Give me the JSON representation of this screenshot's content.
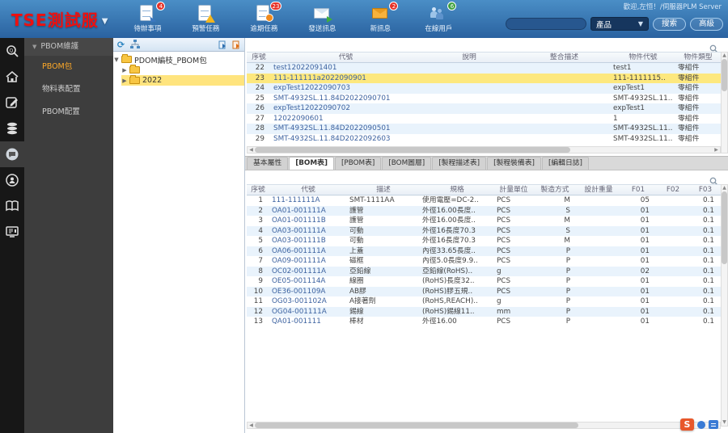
{
  "header": {
    "brand": "TSE測試服",
    "welcome": "歡迎,左恒！/伺服器PLM Server",
    "toolbar": [
      {
        "icon": "todo-icon",
        "label": "待辦事項",
        "badge": "4",
        "badge_color": "red"
      },
      {
        "icon": "warning-task-icon",
        "label": "預警任務",
        "badge": "",
        "badge_color": ""
      },
      {
        "icon": "overdue-task-icon",
        "label": "逾期任務",
        "badge": "23",
        "badge_color": "red"
      },
      {
        "icon": "send-message-icon",
        "label": "發送訊息",
        "badge": "",
        "badge_color": ""
      },
      {
        "icon": "new-message-icon",
        "label": "新訊息",
        "badge": "2",
        "badge_color": "red"
      },
      {
        "icon": "online-users-icon",
        "label": "在線用戶",
        "badge": "6",
        "badge_color": "green"
      }
    ],
    "search": {
      "value": "",
      "placeholder": "",
      "category": "產品",
      "search_btn": "搜索",
      "advanced_btn": "高級"
    }
  },
  "icon_rail": [
    {
      "name": "search-icon",
      "active": false
    },
    {
      "name": "home-icon",
      "active": false
    },
    {
      "name": "edit-icon",
      "active": false
    },
    {
      "name": "database-icon",
      "active": false
    },
    {
      "name": "chat-icon",
      "active": true
    },
    {
      "name": "support-icon",
      "active": false
    },
    {
      "name": "book-icon",
      "active": false
    },
    {
      "name": "monitor-icon",
      "active": false
    }
  ],
  "sidebar": {
    "group": "PBOM維護",
    "items": [
      {
        "label": "PBOM包",
        "selected": true
      },
      {
        "label": "物料表配置",
        "selected": false
      },
      {
        "label": "PBOM配置",
        "selected": false
      }
    ]
  },
  "tree": {
    "root": "PDOM編枝_PBOM包",
    "children": [
      {
        "label": "",
        "selected": false
      },
      {
        "label": "2022",
        "selected": true
      }
    ]
  },
  "top_table": {
    "headers": [
      "序號",
      "代號",
      "說明",
      "整合描述",
      "物件代號",
      "物件類型"
    ],
    "rows": [
      {
        "seq": "22",
        "code": "test12022091401",
        "desc": "",
        "merge_desc": "",
        "obj_code": "test1",
        "obj_type": "零組件",
        "selected": false
      },
      {
        "seq": "23",
        "code": "111-111111a2022090901",
        "desc": "",
        "merge_desc": "",
        "obj_code": "111-1111115..",
        "obj_type": "零組件",
        "selected": true
      },
      {
        "seq": "24",
        "code": "expTest12022090703",
        "desc": "",
        "merge_desc": "",
        "obj_code": "expTest1",
        "obj_type": "零組件",
        "selected": false
      },
      {
        "seq": "25",
        "code": "SMT-4932SL.11.84D2022090701",
        "desc": "",
        "merge_desc": "",
        "obj_code": "SMT-4932SL.11..",
        "obj_type": "零組件",
        "selected": false
      },
      {
        "seq": "26",
        "code": "expTest12022090702",
        "desc": "",
        "merge_desc": "",
        "obj_code": "expTest1",
        "obj_type": "零組件",
        "selected": false
      },
      {
        "seq": "27",
        "code": "12022090601",
        "desc": "",
        "merge_desc": "",
        "obj_code": "1",
        "obj_type": "零組件",
        "selected": false
      },
      {
        "seq": "28",
        "code": "SMT-4932SL.11.84D2022090501",
        "desc": "",
        "merge_desc": "",
        "obj_code": "SMT-4932SL.11..",
        "obj_type": "零組件",
        "selected": false
      },
      {
        "seq": "29",
        "code": "SMT-4932SL.11.84D2022092603",
        "desc": "",
        "merge_desc": "",
        "obj_code": "SMT-4932SL.11..",
        "obj_type": "零組件",
        "selected": false
      }
    ]
  },
  "tabs": [
    {
      "label": "基本屬性",
      "active": false
    },
    {
      "label": "[BOM表]",
      "active": true
    },
    {
      "label": "[PBOM表]",
      "active": false
    },
    {
      "label": "[BOM圖層]",
      "active": false
    },
    {
      "label": "[製程描述表]",
      "active": false
    },
    {
      "label": "[製程裝備表]",
      "active": false
    },
    {
      "label": "[編輯日誌]",
      "active": false
    }
  ],
  "bottom_table": {
    "headers": [
      "序號",
      "代號",
      "描述",
      "規格",
      "計量單位",
      "製造方式",
      "設計重量",
      "F01",
      "F02",
      "F03"
    ],
    "rows": [
      {
        "seq": "1",
        "code": "111-111111A",
        "desc": "SMT-1111AA",
        "spec": "使用電壓=DC-2..",
        "unit": "PCS",
        "make": "M",
        "weight": "",
        "f01": "05",
        "f02": "",
        "f03": "0.1"
      },
      {
        "seq": "2",
        "code": "OA01-001111A",
        "desc": "護管",
        "spec": "外徑16.00長度..",
        "unit": "PCS",
        "make": "S",
        "weight": "",
        "f01": "01",
        "f02": "",
        "f03": "0.1"
      },
      {
        "seq": "3",
        "code": "OA01-001111B",
        "desc": "護管",
        "spec": "外徑16.00長度..",
        "unit": "PCS",
        "make": "M",
        "weight": "",
        "f01": "01",
        "f02": "",
        "f03": "0.1"
      },
      {
        "seq": "4",
        "code": "OA03-001111A",
        "desc": "可動",
        "spec": "外徑16長度70.3",
        "unit": "PCS",
        "make": "S",
        "weight": "",
        "f01": "01",
        "f02": "",
        "f03": "0.1"
      },
      {
        "seq": "5",
        "code": "OA03-001111B",
        "desc": "可動",
        "spec": "外徑16長度70.3",
        "unit": "PCS",
        "make": "M",
        "weight": "",
        "f01": "01",
        "f02": "",
        "f03": "0.1"
      },
      {
        "seq": "6",
        "code": "OA06-001111A",
        "desc": "上蓋",
        "spec": "內徑33.65長度..",
        "unit": "PCS",
        "make": "P",
        "weight": "",
        "f01": "01",
        "f02": "",
        "f03": "0.1"
      },
      {
        "seq": "7",
        "code": "OA09-001111A",
        "desc": "磁框",
        "spec": "內徑5.0長度9.9..",
        "unit": "PCS",
        "make": "P",
        "weight": "",
        "f01": "01",
        "f02": "",
        "f03": "0.1"
      },
      {
        "seq": "8",
        "code": "OC02-001111A",
        "desc": "亞鉛線",
        "spec": "亞鉛線(RoHS)..",
        "unit": "g",
        "make": "P",
        "weight": "",
        "f01": "02",
        "f02": "",
        "f03": "0.1"
      },
      {
        "seq": "9",
        "code": "OE05-001114A",
        "desc": "線圈",
        "spec": "(RoHS)長度32..",
        "unit": "PCS",
        "make": "P",
        "weight": "",
        "f01": "01",
        "f02": "",
        "f03": "0.1"
      },
      {
        "seq": "10",
        "code": "OE36-001109A",
        "desc": "AB膠",
        "spec": "(RoHS)膠五規..",
        "unit": "PCS",
        "make": "P",
        "weight": "",
        "f01": "01",
        "f02": "",
        "f03": "0.1"
      },
      {
        "seq": "11",
        "code": "OG03-001102A",
        "desc": "A接著劑",
        "spec": "(RoHS,REACH)..",
        "unit": "g",
        "make": "P",
        "weight": "",
        "f01": "01",
        "f02": "",
        "f03": "0.1"
      },
      {
        "seq": "12",
        "code": "OG04-001111A",
        "desc": "錫線",
        "spec": "(RoHS)錫線11..",
        "unit": "mm",
        "make": "P",
        "weight": "",
        "f01": "01",
        "f02": "",
        "f03": "0.1"
      },
      {
        "seq": "13",
        "code": "QA01-001111",
        "desc": "棒材",
        "spec": "外徑16.00",
        "unit": "PCS",
        "make": "P",
        "weight": "",
        "f01": "01",
        "f02": "",
        "f03": "0.1"
      }
    ]
  },
  "plugins": {
    "s_label": "S"
  }
}
